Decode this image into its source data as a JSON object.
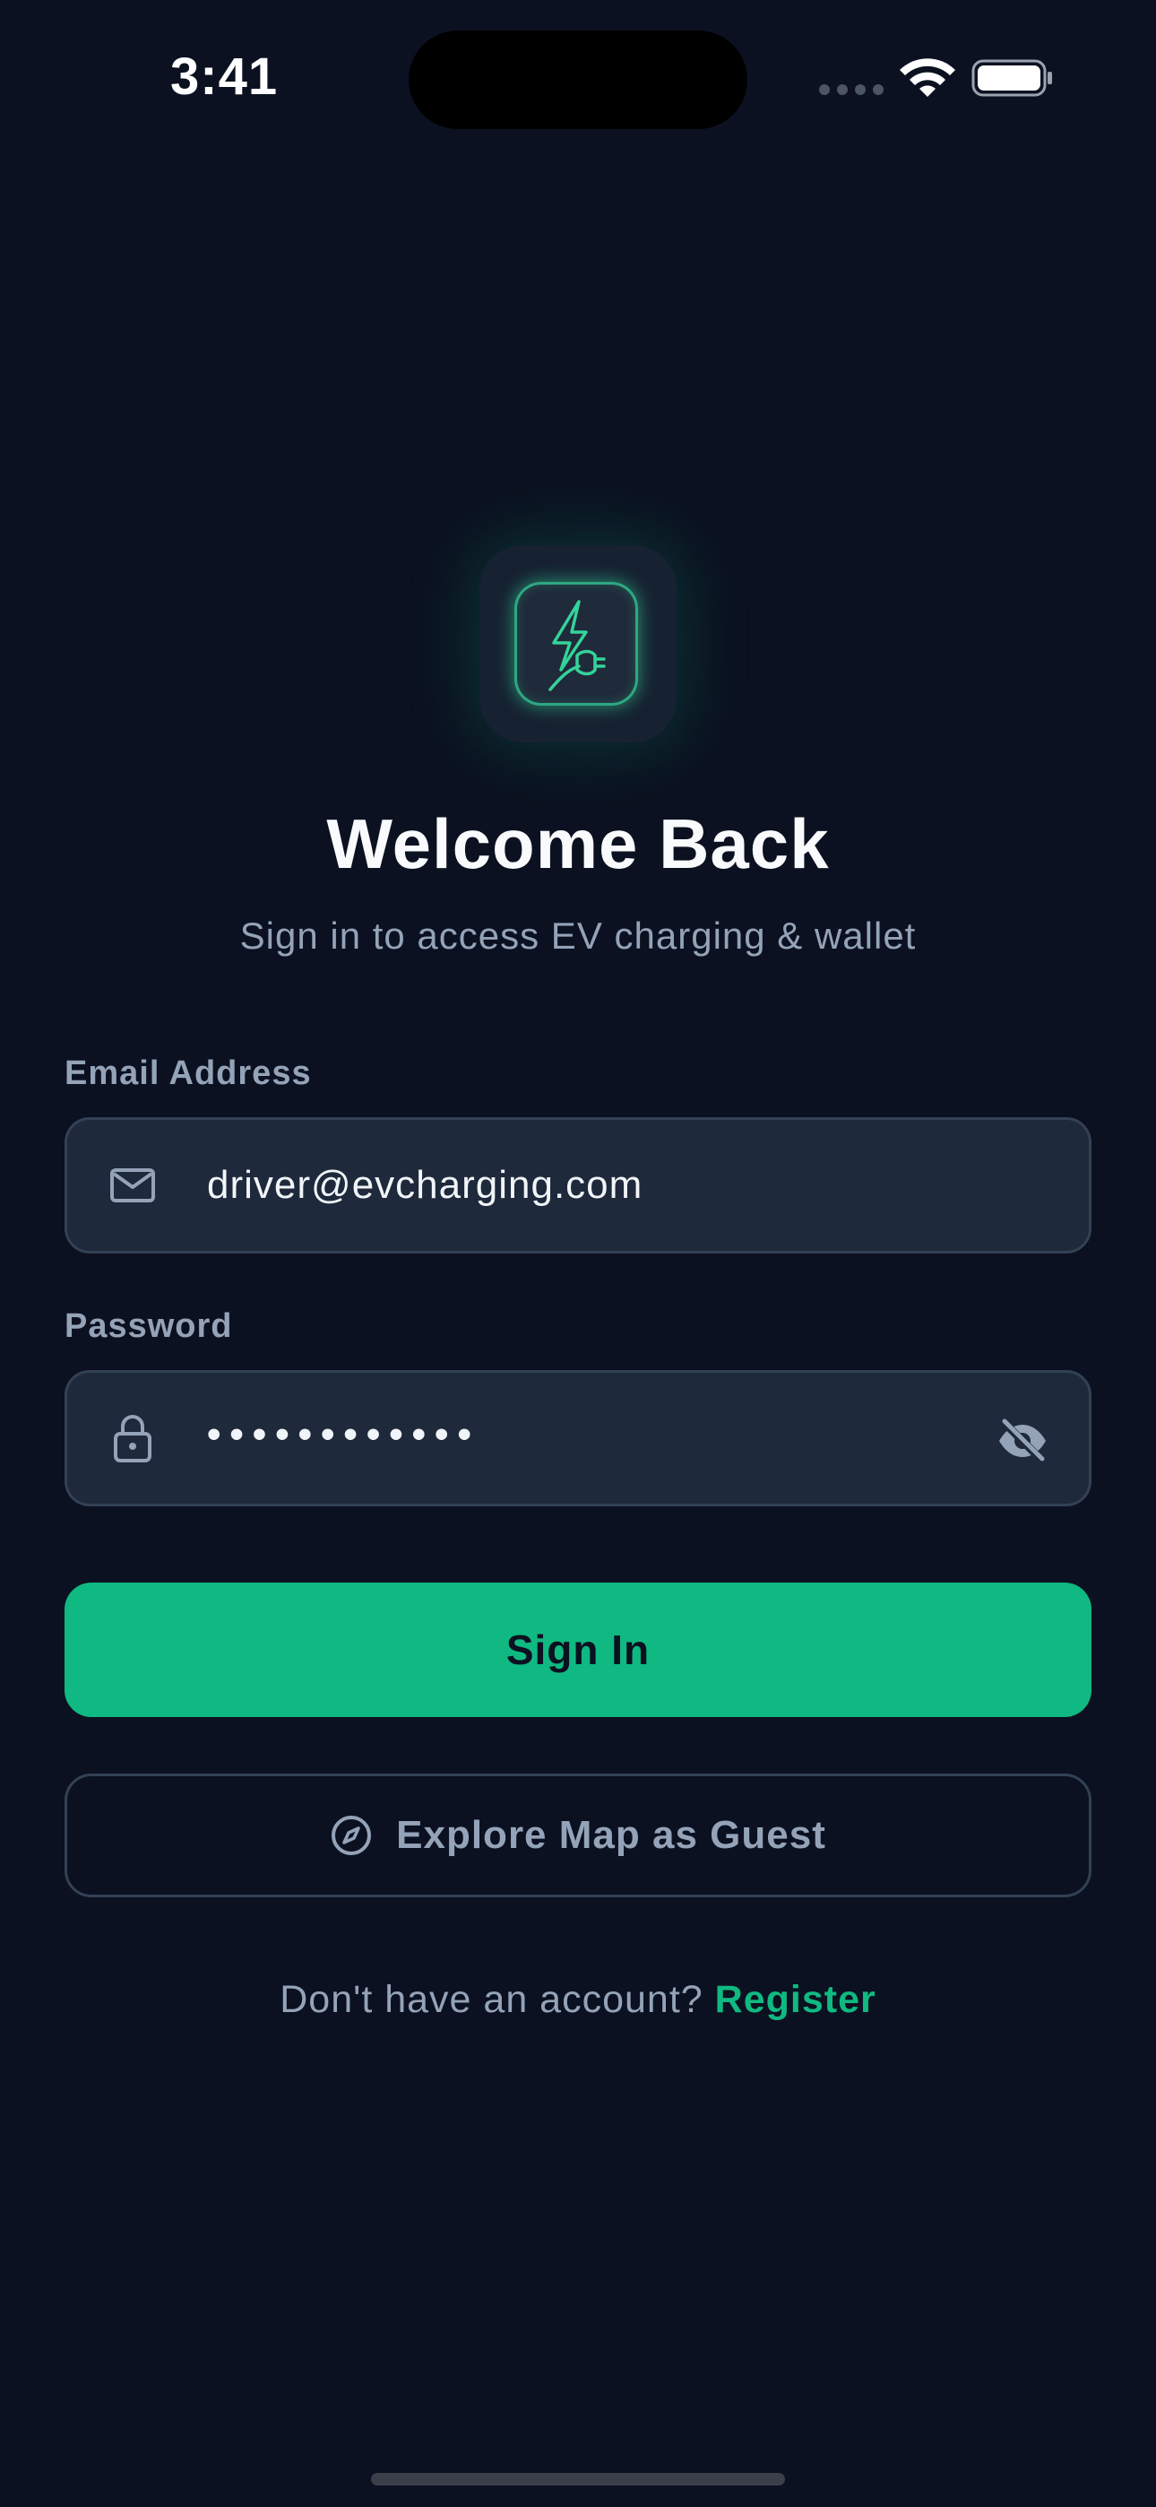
{
  "status_bar": {
    "time": "3:41"
  },
  "login": {
    "title": "Welcome Back",
    "subtitle": "Sign in to access EV charging & wallet",
    "email": {
      "label": "Email Address",
      "value": "driver@evcharging.com",
      "icon": "mail-icon"
    },
    "password": {
      "label": "Password",
      "value": "••••••••••••",
      "icon": "lock-icon",
      "toggle_icon": "eye-off-icon"
    },
    "sign_in_label": "Sign In",
    "guest_label": "Explore Map as Guest",
    "guest_icon": "compass-icon",
    "register_prompt": "Don't have an account?",
    "register_link": "Register"
  },
  "colors": {
    "background": "#0b1120",
    "accent": "#10b981",
    "field_bg": "#1e293b",
    "muted_text": "#94a3b8"
  }
}
